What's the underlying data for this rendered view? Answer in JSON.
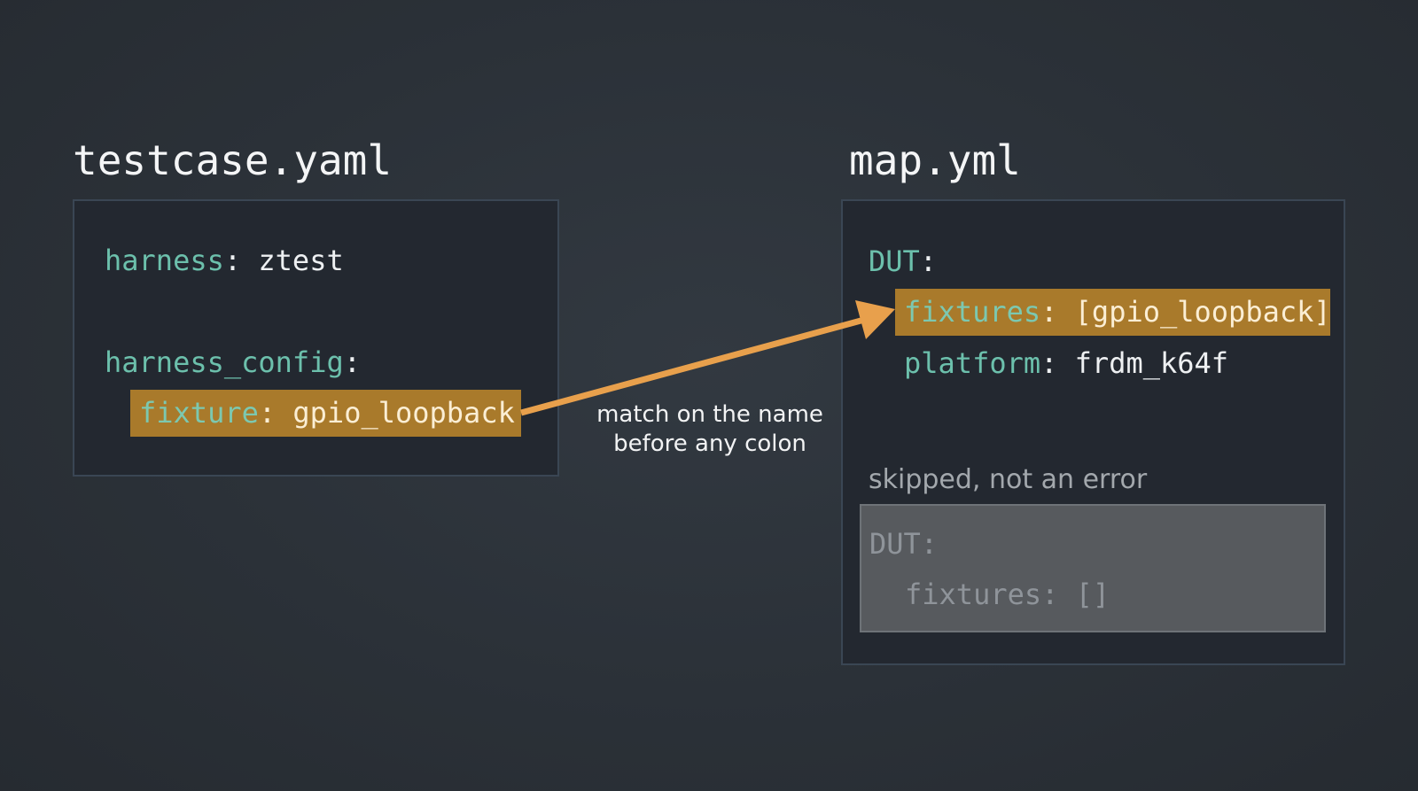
{
  "left_file": {
    "title": "testcase.yaml",
    "lines": [
      {
        "key": "harness",
        "sep": ": ",
        "value": "ztest"
      },
      {
        "key": "harness_config",
        "sep": ":",
        "value": ""
      }
    ],
    "highlight": {
      "key": "fixture",
      "sep": ": ",
      "value": "gpio_loopback"
    }
  },
  "right_file": {
    "title": "map.yml",
    "root": {
      "key": "DUT",
      "sep": ":"
    },
    "highlight": {
      "key": "fixtures",
      "sep": ": ",
      "value": "[gpio_loopback]"
    },
    "lines": [
      {
        "key": "platform",
        "sep": ": ",
        "value": "frdm_k64f"
      }
    ],
    "skipped": {
      "caption": "skipped, not an error",
      "root": {
        "key": "DUT",
        "sep": ":"
      },
      "line": {
        "key": "fixtures",
        "sep": ": ",
        "value": "[]"
      }
    }
  },
  "annotation": {
    "line1": "match on the name",
    "line2": "before any colon"
  },
  "colors": {
    "background": "#2b3138",
    "panel": "#232830",
    "key": "#6cc0ac",
    "highlight": "#a97a2b",
    "arrow": "#e8a04c",
    "skipped_box": "#575a5e"
  }
}
